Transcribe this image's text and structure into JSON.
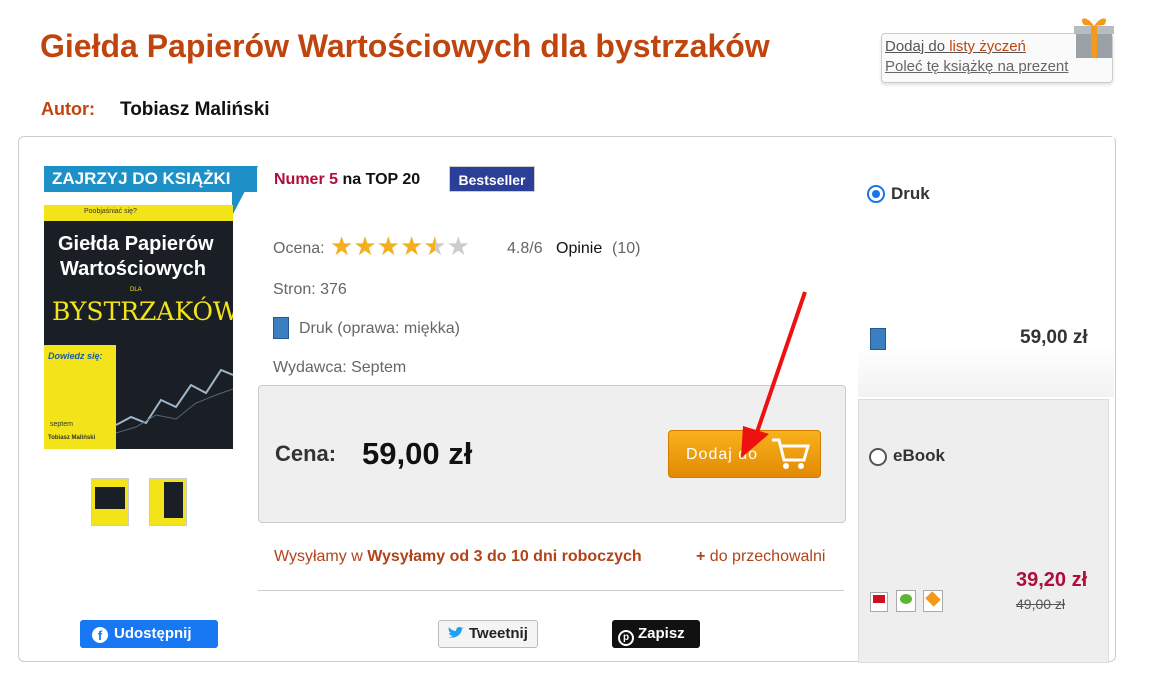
{
  "title": "Giełda Papierów Wartościowych dla bystrzaków",
  "author": {
    "label": "Autor:",
    "name": "Tobiasz Maliński"
  },
  "wishlist": {
    "prefix": "Dodaj do ",
    "link": "listy życzeń",
    "gift": "Poleć tę książkę na prezent"
  },
  "cover": {
    "banner": "ZAJRZYJ DO KSIĄŻKI",
    "tagline": "Poobjaśniać się?",
    "title_line1": "Giełda Papierów",
    "title_line2": "Wartościowych",
    "dla": "DLA",
    "brand": "BYSTRZAKÓW",
    "learn": "Dowiedz się:",
    "publisher": "septem",
    "author": "Tobiasz Maliński"
  },
  "ranking": {
    "number": "Numer 5",
    "rest": " na TOP 20",
    "badge": "Bestseller"
  },
  "rating": {
    "label": "Ocena:",
    "value": 4.8,
    "value_text": "4.8/6",
    "opinions_label": "Opinie",
    "opinions_count": "(10)"
  },
  "details": {
    "pages": "Stron: 376",
    "format": "Druk (oprawa: miękka)",
    "publisher": "Wydawca: Septem"
  },
  "price": {
    "label": "Cena:",
    "value": "59,00 zł",
    "cart_button": "Dodaj do"
  },
  "shipping": {
    "prefix": "Wysyłamy w ",
    "bold": "Wysyłamy od 3 do 10 dni roboczych",
    "storage_plus": "+",
    "storage": "do przechowalni"
  },
  "share": {
    "facebook": "Udostępnij",
    "twitter": "Tweetnij",
    "pinterest": "Zapisz"
  },
  "formats": {
    "druk": {
      "label": "Druk",
      "price": "59,00 zł",
      "selected": true
    },
    "ebook": {
      "label": "eBook",
      "price": "39,20 zł",
      "old_price": "49,00 zł",
      "selected": false
    }
  },
  "colors": {
    "brand": "#c0440e",
    "accent": "#b00d3c",
    "cart": "#f0a010",
    "bestseller": "#2b3f98"
  }
}
